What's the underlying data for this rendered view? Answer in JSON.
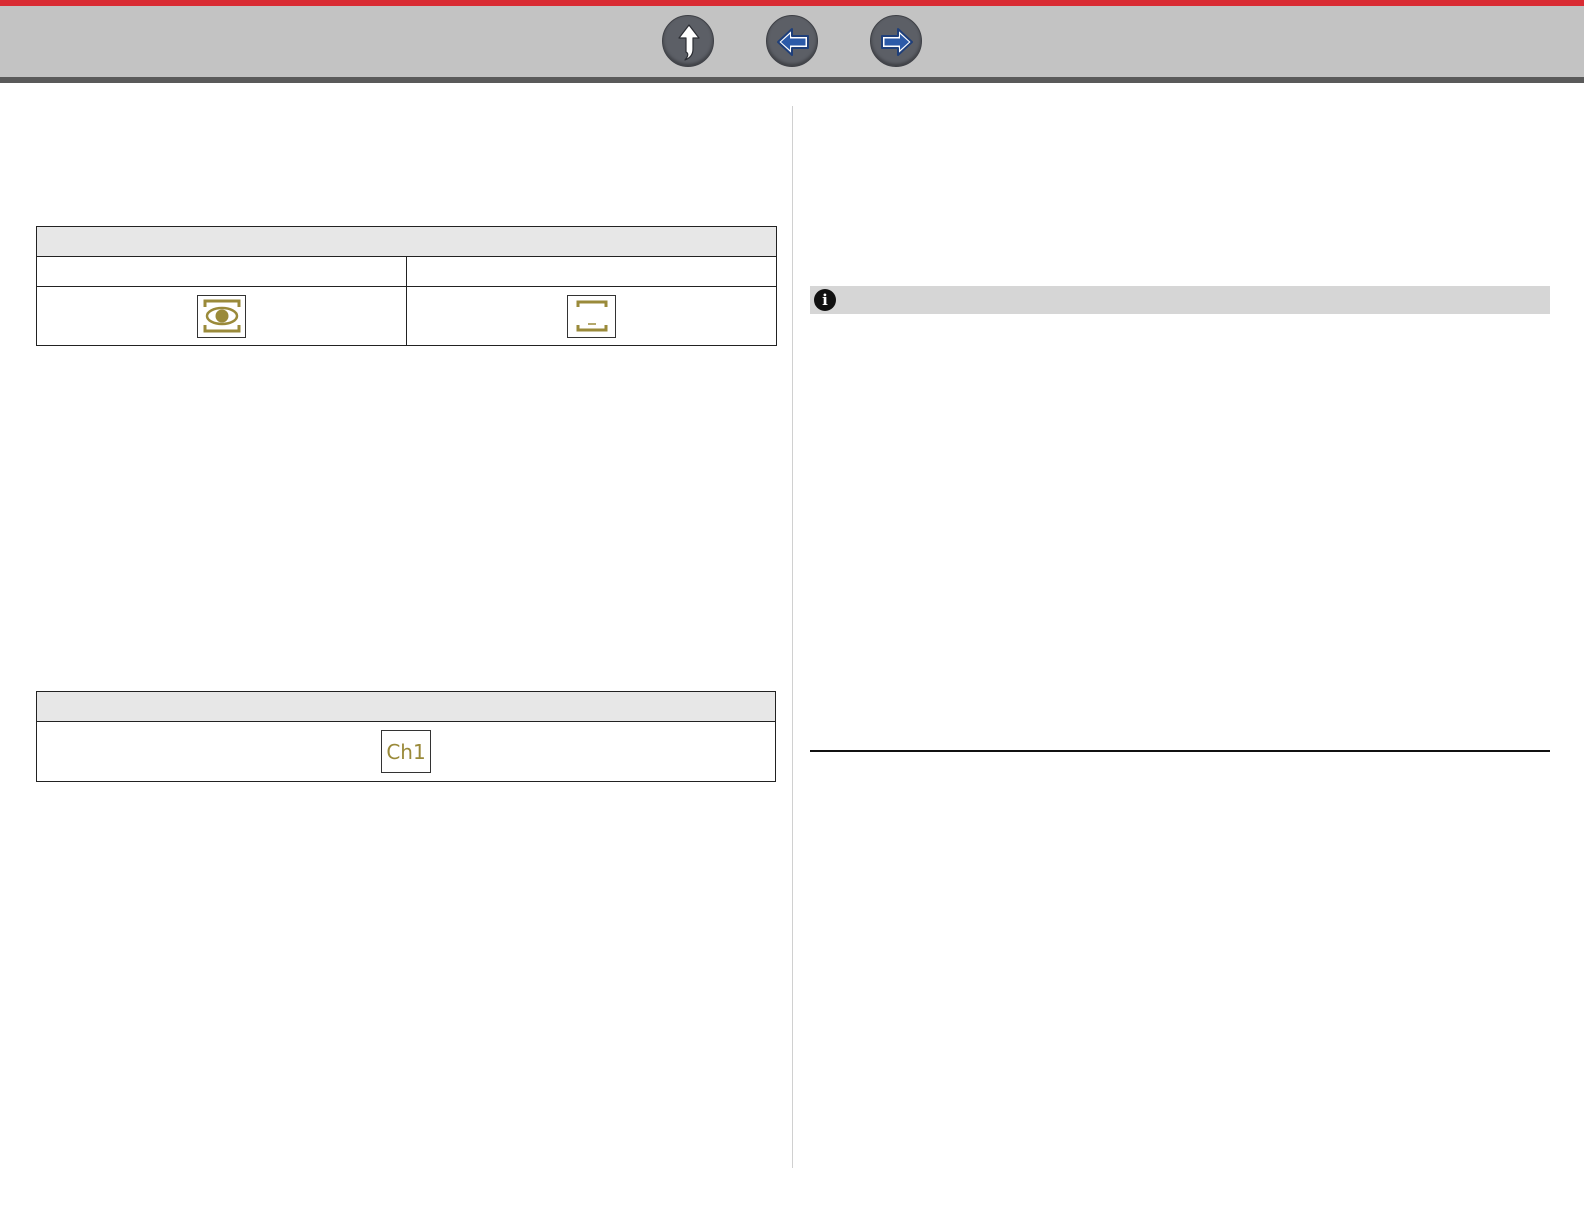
{
  "nav": {
    "up_icon": "up-arrow-icon",
    "back_icon": "left-arrow-icon",
    "forward_icon": "right-arrow-icon"
  },
  "colors": {
    "top_stripe": "#d92b33",
    "toolbar": "#c3c3c3",
    "icon_gold": "#9a8a3a",
    "table_header": "#e7e7e7",
    "note_bar": "#d6d6d6"
  },
  "table_1": {
    "icons": [
      "eye-in-brackets-icon",
      "empty-brackets-icon"
    ]
  },
  "table_2": {
    "icon_label": "Ch1"
  },
  "note": {
    "icon": "info-icon",
    "glyph": "i"
  }
}
